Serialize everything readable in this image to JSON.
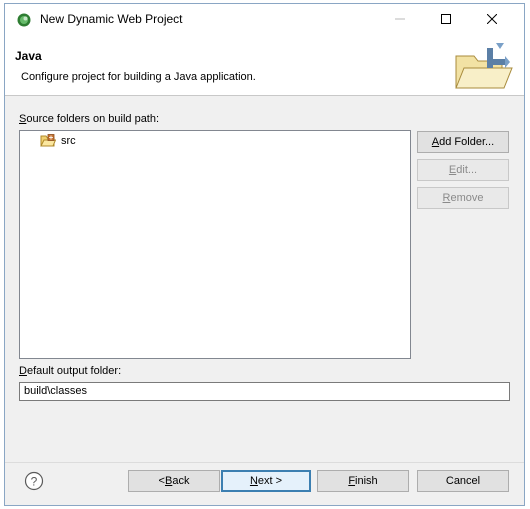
{
  "window": {
    "title": "New Dynamic Web Project"
  },
  "banner": {
    "title": "Java",
    "description": "Configure project for building a Java application."
  },
  "source_folders": {
    "label_accel": "S",
    "label_rest": "ource folders on build path:",
    "items": [
      {
        "label": "src",
        "icon": "source-folder-icon"
      }
    ]
  },
  "side_buttons": {
    "add_folder_accel": "A",
    "add_folder_rest": "dd Folder...",
    "edit_accel": "E",
    "edit_rest": "dit...",
    "remove_accel": "R",
    "remove_rest": "emove"
  },
  "output": {
    "label_accel": "D",
    "label_rest": "efault output folder:",
    "value": "build\\classes"
  },
  "footer": {
    "back_prefix": "< ",
    "back_accel": "B",
    "back_rest": "ack",
    "next_accel": "N",
    "next_rest": "ext >",
    "finish_accel": "F",
    "finish_rest": "inish",
    "cancel": "Cancel"
  },
  "colors": {
    "accent": "#3c7fb1",
    "disabled_text": "#8a8a8a",
    "title_icon": "#2e7d32"
  }
}
